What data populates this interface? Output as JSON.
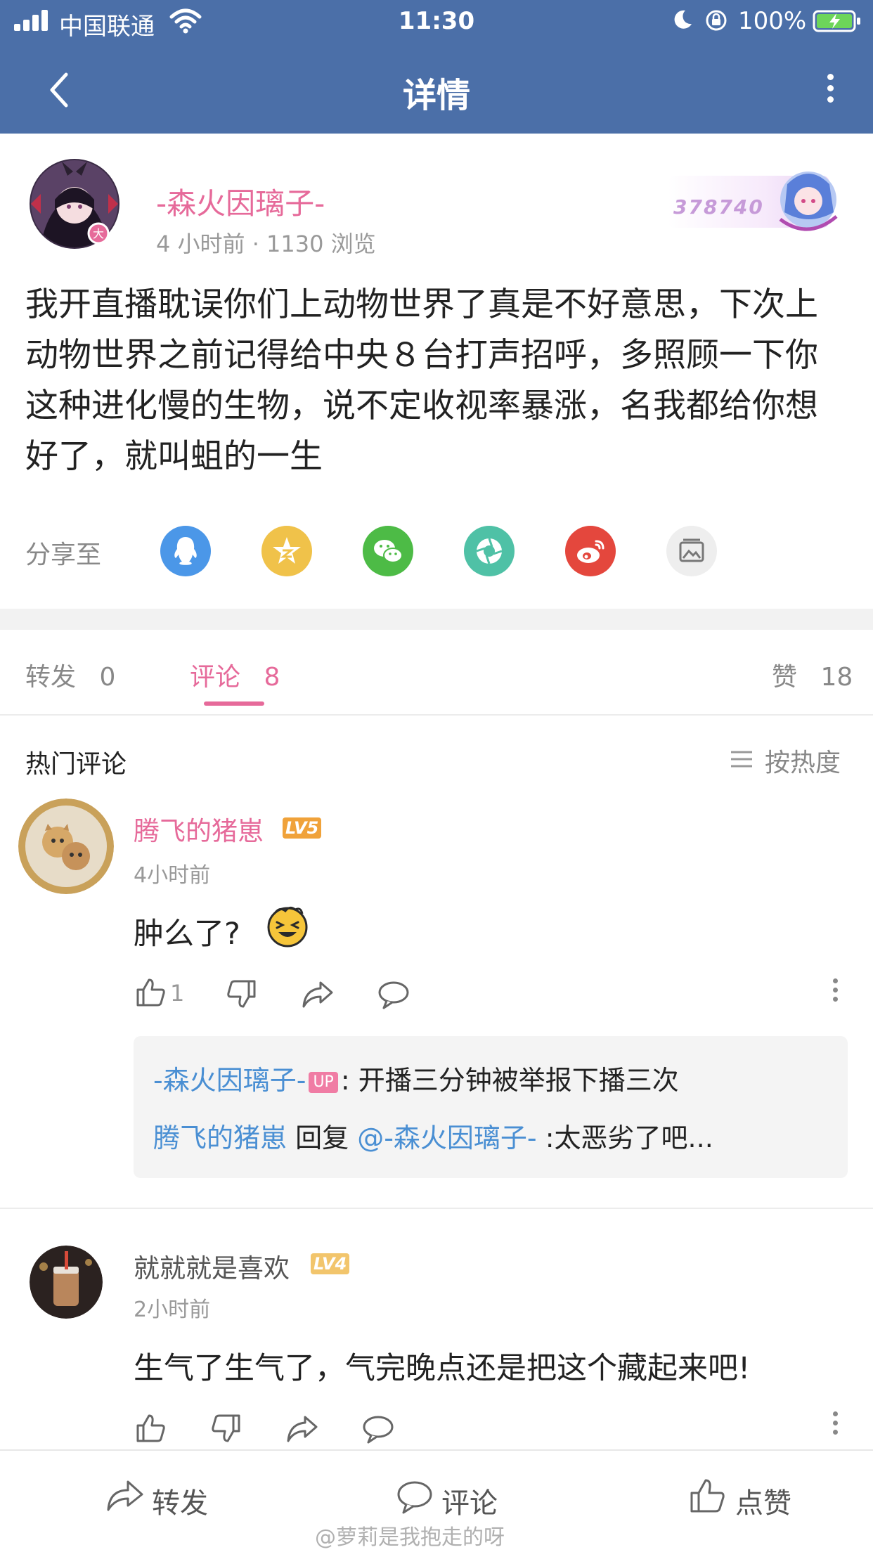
{
  "status_bar": {
    "carrier": "中国联通",
    "time": "11:30",
    "battery": "100%"
  },
  "nav": {
    "title": "详情"
  },
  "post": {
    "author": "-森火因璃子-",
    "meta": "4 小时前 · 1130 浏览",
    "badge_number": "378740",
    "body": "我开直播耽误你们上动物世界了真是不好意思，下次上动物世界之前记得给中央８台打声招呼，多照顾一下你这种进化慢的生物，说不定收视率暴涨，名我都给你想好了，就叫蛆的一生"
  },
  "share": {
    "label": "分享至",
    "targets": [
      "qq-icon",
      "qzone-icon",
      "wechat-icon",
      "moments-icon",
      "weibo-icon",
      "image-save-icon"
    ],
    "colors": {
      "qq": "#4b97e8",
      "qzone": "#f0c24a",
      "wechat": "#4dbb46",
      "moments": "#4fc1a6",
      "weibo": "#e4473d",
      "image": "#eeeeee"
    }
  },
  "tabs": {
    "repost_label": "转发",
    "repost_count": "0",
    "comment_label": "评论",
    "comment_count": "8",
    "like_label": "赞",
    "like_count": "18"
  },
  "comments_header": {
    "title": "热门评论",
    "sort": "按热度"
  },
  "comments": [
    {
      "name": "腾飞的猪崽",
      "level": "LV5",
      "time": "4小时前",
      "text": "肿么了?",
      "likes": "1",
      "replies": [
        {
          "author": "-森火因璃子-",
          "tag": "UP",
          "text": ": 开播三分钟被举报下播三次"
        },
        {
          "author": "腾飞的猪崽",
          "verb": "回复",
          "mention": "@-森火因璃子-",
          "text": ":太恶劣了吧..."
        }
      ]
    },
    {
      "name": "就就就是喜欢",
      "level": "LV4",
      "time": "2小时前",
      "text": "生气了生气了，气完晚点还是把这个藏起来吧!"
    }
  ],
  "bottom_bar": {
    "repost": "转发",
    "comment": "评论",
    "like": "点赞"
  },
  "watermark": "@萝莉是我抱走的呀",
  "colors": {
    "nav_bg": "#4b6fa8",
    "accent_pink": "#e66a9a",
    "link_blue": "#4a8fd3",
    "level5": "#f0a23a",
    "level4": "#f2c56c"
  }
}
